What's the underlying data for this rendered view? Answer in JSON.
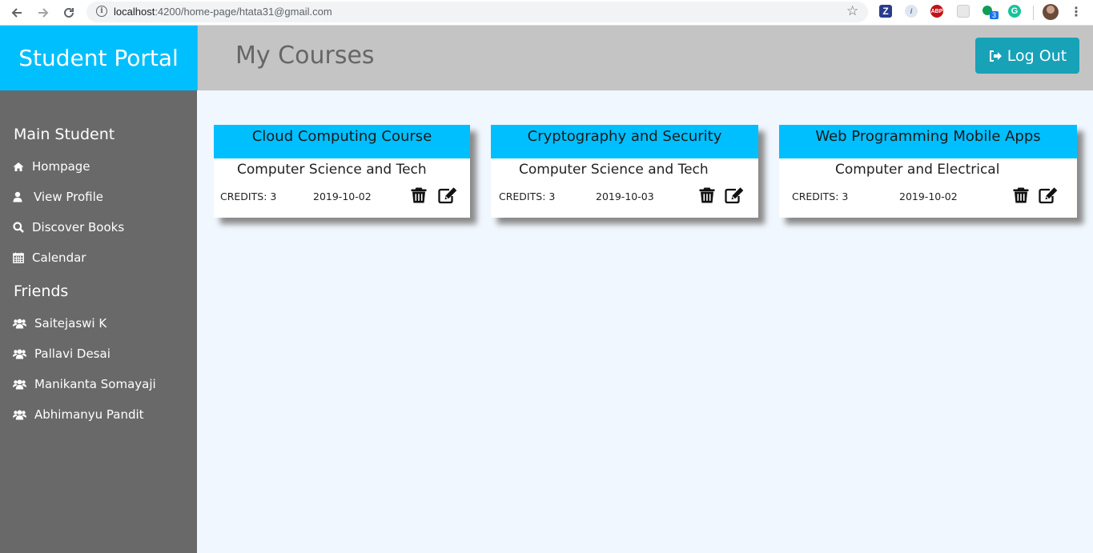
{
  "browser": {
    "url_host": "localhost",
    "url_rest": ":4200/home-page/htata31@gmail.com",
    "extension_badge": "3"
  },
  "app": {
    "brand": "Student Portal",
    "page_title": "My Courses",
    "logout_label": "Log Out"
  },
  "sidebar": {
    "main_heading": "Main Student",
    "main_items": [
      {
        "label": "Hompage",
        "icon": "home-icon"
      },
      {
        "label": "View Profile",
        "icon": "user-icon"
      },
      {
        "label": "Discover Books",
        "icon": "search-icon"
      },
      {
        "label": "Calendar",
        "icon": "calendar-icon"
      }
    ],
    "friends_heading": "Friends",
    "friends": [
      {
        "label": "Saitejaswi K",
        "icon": "users-icon"
      },
      {
        "label": "Pallavi Desai",
        "icon": "users-icon"
      },
      {
        "label": "Manikanta Somayaji",
        "icon": "users-icon"
      },
      {
        "label": "Abhimanyu Pandit",
        "icon": "users-icon"
      }
    ]
  },
  "courses": [
    {
      "title": "Cloud Computing Course",
      "department": "Computer Science and Tech",
      "credits": "CREDITS: 3",
      "date": "2019-10-02"
    },
    {
      "title": "Cryptography and Security",
      "department": "Computer Science and Tech",
      "credits": "CREDITS: 3",
      "date": "2019-10-03"
    },
    {
      "title": "Web Programming Mobile Apps",
      "department": "Computer and Electrical",
      "credits": "CREDITS: 3",
      "date": "2019-10-02"
    }
  ],
  "colors": {
    "brand_blue": "#00bfff",
    "header_gray": "#c4c4c4",
    "sidebar_gray": "#696969",
    "logout_teal": "#17a2b8",
    "content_bg": "#f0f7fe"
  }
}
